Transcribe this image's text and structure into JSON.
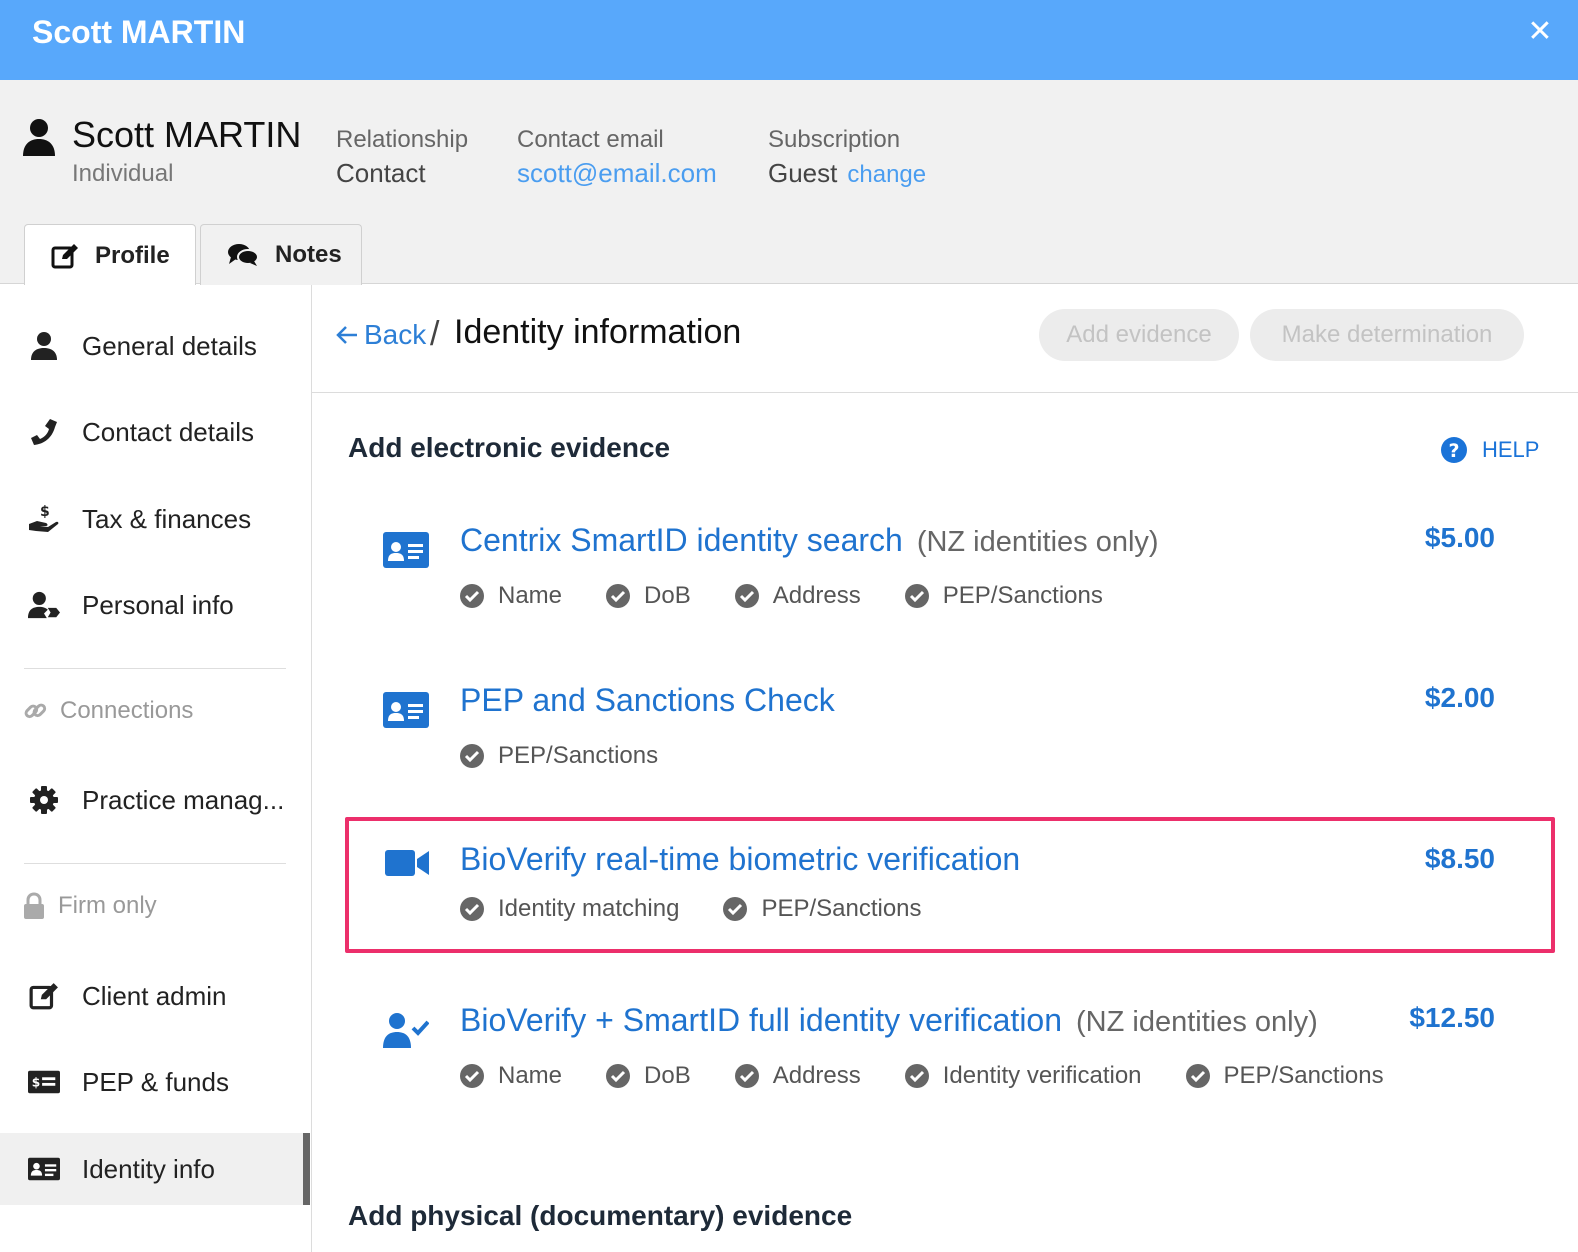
{
  "window": {
    "title": "Scott MARTIN",
    "close_glyph": "✕"
  },
  "profile": {
    "name": "Scott MARTIN",
    "type": "Individual",
    "relationship_label": "Relationship",
    "relationship_value": "Contact",
    "email_label": "Contact email",
    "email_value": "scott@email.com",
    "subscription_label": "Subscription",
    "subscription_value": "Guest",
    "subscription_change": "change"
  },
  "tabs": [
    {
      "label": "Profile",
      "icon": "edit-icon",
      "active": true
    },
    {
      "label": "Notes",
      "icon": "comments-icon",
      "active": false
    }
  ],
  "sidebar": {
    "items": [
      {
        "label": "General details",
        "icon": "user-icon"
      },
      {
        "label": "Contact details",
        "icon": "phone-icon"
      },
      {
        "label": "Tax & finances",
        "icon": "hand-dollar-icon"
      },
      {
        "label": "Personal info",
        "icon": "user-tag-icon"
      },
      {
        "label": "Practice manag...",
        "icon": "gear-icon"
      },
      {
        "label": "Client admin",
        "icon": "edit-icon"
      },
      {
        "label": "PEP & funds",
        "icon": "money-card-icon"
      },
      {
        "label": "Identity info",
        "icon": "id-card-icon",
        "active": true
      }
    ],
    "sections": {
      "connections": "Connections",
      "firm_only": "Firm only"
    }
  },
  "breadcrumb": {
    "back": "Back",
    "separator": "/",
    "title": "Identity information"
  },
  "actions": {
    "add_evidence": "Add evidence",
    "make_determination": "Make determination"
  },
  "electronic": {
    "heading": "Add electronic evidence",
    "help": "HELP",
    "items": [
      {
        "title": "Centrix SmartID identity search",
        "note": "(NZ identities only)",
        "price": "$5.00",
        "icon": "id-card-icon",
        "checks": [
          "Name",
          "DoB",
          "Address",
          "PEP/Sanctions"
        ]
      },
      {
        "title": "PEP and Sanctions Check",
        "note": "",
        "price": "$2.00",
        "icon": "id-card-icon",
        "checks": [
          "PEP/Sanctions"
        ]
      },
      {
        "title": "BioVerify real-time biometric verification",
        "note": "",
        "price": "$8.50",
        "icon": "video-camera-icon",
        "highlighted": true,
        "checks": [
          "Identity matching",
          "PEP/Sanctions"
        ]
      },
      {
        "title": "BioVerify + SmartID full identity verification",
        "note": "(NZ identities only)",
        "price": "$12.50",
        "icon": "user-check-icon",
        "checks": [
          "Name",
          "DoB",
          "Address",
          "Identity verification",
          "PEP/Sanctions"
        ]
      }
    ]
  },
  "physical": {
    "heading": "Add physical (documentary) evidence"
  },
  "colors": {
    "titlebar": "#58a8fb",
    "link": "#1f73cf",
    "highlight": "#ec2f6b"
  }
}
